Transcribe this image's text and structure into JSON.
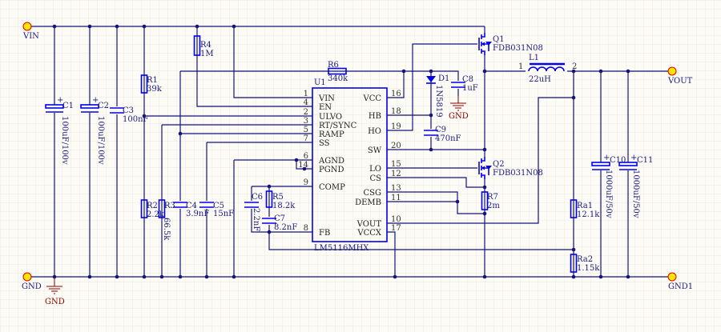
{
  "ports": {
    "vin": "VIN",
    "gnd": "GND",
    "vout": "VOUT",
    "gnd1": "GND1"
  },
  "gnd_symbols": [
    "GND",
    "GND"
  ],
  "ic": {
    "ref": "U1",
    "part": "LM5116MHX",
    "left_pins": [
      {
        "num": "1",
        "name": "VIN"
      },
      {
        "num": "4",
        "name": "EN"
      },
      {
        "num": "2",
        "name": "ULVO"
      },
      {
        "num": "3",
        "name": "RT/SYNC"
      },
      {
        "num": "5",
        "name": "RAMP"
      },
      {
        "num": "7",
        "name": "SS"
      },
      {
        "num": "6",
        "name": "AGND"
      },
      {
        "num": "14",
        "name": "PGND"
      },
      {
        "num": "9",
        "name": "COMP"
      },
      {
        "num": "8",
        "name": "FB"
      }
    ],
    "right_pins": [
      {
        "num": "16",
        "name": "VCC"
      },
      {
        "num": "18",
        "name": "HB"
      },
      {
        "num": "19",
        "name": "HO"
      },
      {
        "num": "20",
        "name": "SW"
      },
      {
        "num": "15",
        "name": "LO"
      },
      {
        "num": "12",
        "name": "CS"
      },
      {
        "num": "13",
        "name": "CSG"
      },
      {
        "num": "11",
        "name": "DEMB"
      },
      {
        "num": "10",
        "name": "VOUT"
      },
      {
        "num": "17",
        "name": "VCCX"
      }
    ]
  },
  "components": {
    "C1": {
      "ref": "C1",
      "value": "100uF/100v"
    },
    "C2": {
      "ref": "C2",
      "value": "100uF/100v"
    },
    "C3": {
      "ref": "C3",
      "value": "100nF"
    },
    "R1": {
      "ref": "R1",
      "value": "39k"
    },
    "R4": {
      "ref": "R4",
      "value": "1M"
    },
    "R6": {
      "ref": "R6",
      "value": "340k"
    },
    "R2": {
      "ref": "R2",
      "value": "2.2k"
    },
    "R3": {
      "ref": "R3",
      "value": "66.5k"
    },
    "C4": {
      "ref": "C4",
      "value": "3.9nF"
    },
    "C5": {
      "ref": "C5",
      "value": "15nF"
    },
    "C6": {
      "ref": "C6",
      "value": "2.2nF"
    },
    "R5": {
      "ref": "R5",
      "value": "18.2k"
    },
    "C7": {
      "ref": "C7",
      "value": "8.2nF"
    },
    "D1": {
      "ref": "D1",
      "value": "1N5819"
    },
    "C8": {
      "ref": "C8",
      "value": "1uF"
    },
    "C9": {
      "ref": "C9",
      "value": "470nF"
    },
    "Q1": {
      "ref": "Q1",
      "value": "FDB031N08"
    },
    "Q2": {
      "ref": "Q2",
      "value": "FDB031N08"
    },
    "R7": {
      "ref": "R7",
      "value": "2m"
    },
    "L1": {
      "ref": "L1",
      "value": "22uH",
      "pin1": "1",
      "pin2": "2"
    },
    "Ra1": {
      "ref": "Ra1",
      "value": "12.1k"
    },
    "Ra2": {
      "ref": "Ra2",
      "value": "1.15k"
    },
    "C10": {
      "ref": "C10",
      "value": "1000uF/50v"
    },
    "C11": {
      "ref": "C11",
      "value": "1000uF/50v"
    }
  },
  "colors": {
    "wire": "#14147a",
    "component": "#0000ee",
    "gnd": "#8b0000",
    "port_fill": "#ffe600",
    "port_stroke": "#e00000"
  }
}
